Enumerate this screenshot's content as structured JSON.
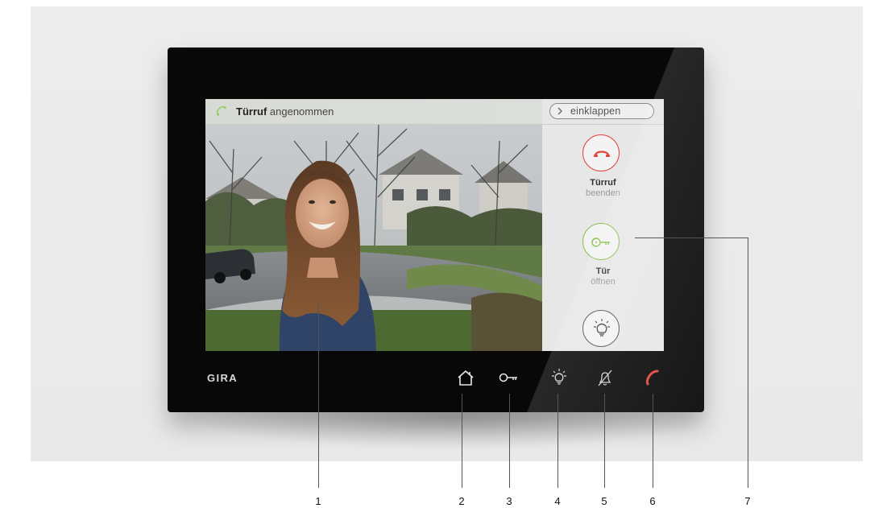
{
  "status_bar": {
    "title_bold": "Türruf",
    "title_rest": "angenommen",
    "collapse_label": "einklappen",
    "call_icon": "phone-handset-icon",
    "collapse_icon": "chevron-right-icon"
  },
  "side_panel": {
    "actions": [
      {
        "title": "Türruf",
        "subtitle": "beenden",
        "icon": "hang-up-icon",
        "color": "#e0463a"
      },
      {
        "title": "Tür",
        "subtitle": "öffnen",
        "icon": "key-icon",
        "color": "#8cc152"
      },
      {
        "title": "",
        "subtitle": "",
        "icon": "light-bulb-icon",
        "color": "#5a5a5a"
      }
    ]
  },
  "device": {
    "brand": "GIRA",
    "buttons": [
      {
        "icon": "home-icon"
      },
      {
        "icon": "key-icon"
      },
      {
        "icon": "light-bulb-icon"
      },
      {
        "icon": "bell-muted-icon"
      },
      {
        "icon": "phone-handset-icon",
        "color": "#e0463a"
      }
    ]
  },
  "callouts": [
    "1",
    "2",
    "3",
    "4",
    "5",
    "6",
    "7"
  ],
  "colors": {
    "hang_up": "#e0463a",
    "door_open": "#8cc152",
    "bezel": "#080808"
  }
}
